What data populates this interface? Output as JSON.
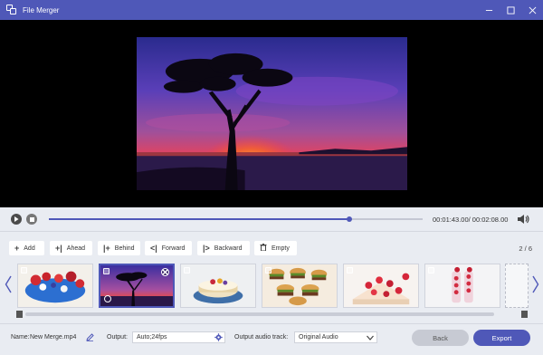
{
  "window": {
    "title": "File Merger",
    "controls": [
      "minimize-icon",
      "restore-icon",
      "close-icon"
    ]
  },
  "player": {
    "current_time": "00:01:43.00",
    "total_time": "00:02:08.00",
    "time_display": "00:01:43.00/ 00:02:08.00",
    "progress_fraction": 0.805
  },
  "toolbar": {
    "buttons": [
      {
        "icon": "plus-icon",
        "label": "Add"
      },
      {
        "icon": "ahead-icon",
        "label": "Ahead"
      },
      {
        "icon": "behind-icon",
        "label": "Behind"
      },
      {
        "icon": "forward-icon",
        "label": "Forward"
      },
      {
        "icon": "backward-icon",
        "label": "Backward"
      },
      {
        "icon": "trash-icon",
        "label": "Empty"
      }
    ],
    "page_count": "2 / 6"
  },
  "clips": [
    {
      "subject": "berries",
      "selected": false
    },
    {
      "subject": "sunset-tree",
      "selected": true
    },
    {
      "subject": "cake",
      "selected": false
    },
    {
      "subject": "burgers",
      "selected": false
    },
    {
      "subject": "strawberry-cake",
      "selected": false
    },
    {
      "subject": "strawberry-drinks",
      "selected": false
    }
  ],
  "footer": {
    "name_label": "Name:",
    "name_value": "New Merge.mp4",
    "output_label": "Output:",
    "output_value": "Auto;24fps",
    "audio_label": "Output audio track:",
    "audio_value": "Original Audio",
    "back_label": "Back",
    "export_label": "Export"
  },
  "colors": {
    "accent": "#4f58b8",
    "background": "#e9ecf2",
    "video_bg": "#000000"
  }
}
